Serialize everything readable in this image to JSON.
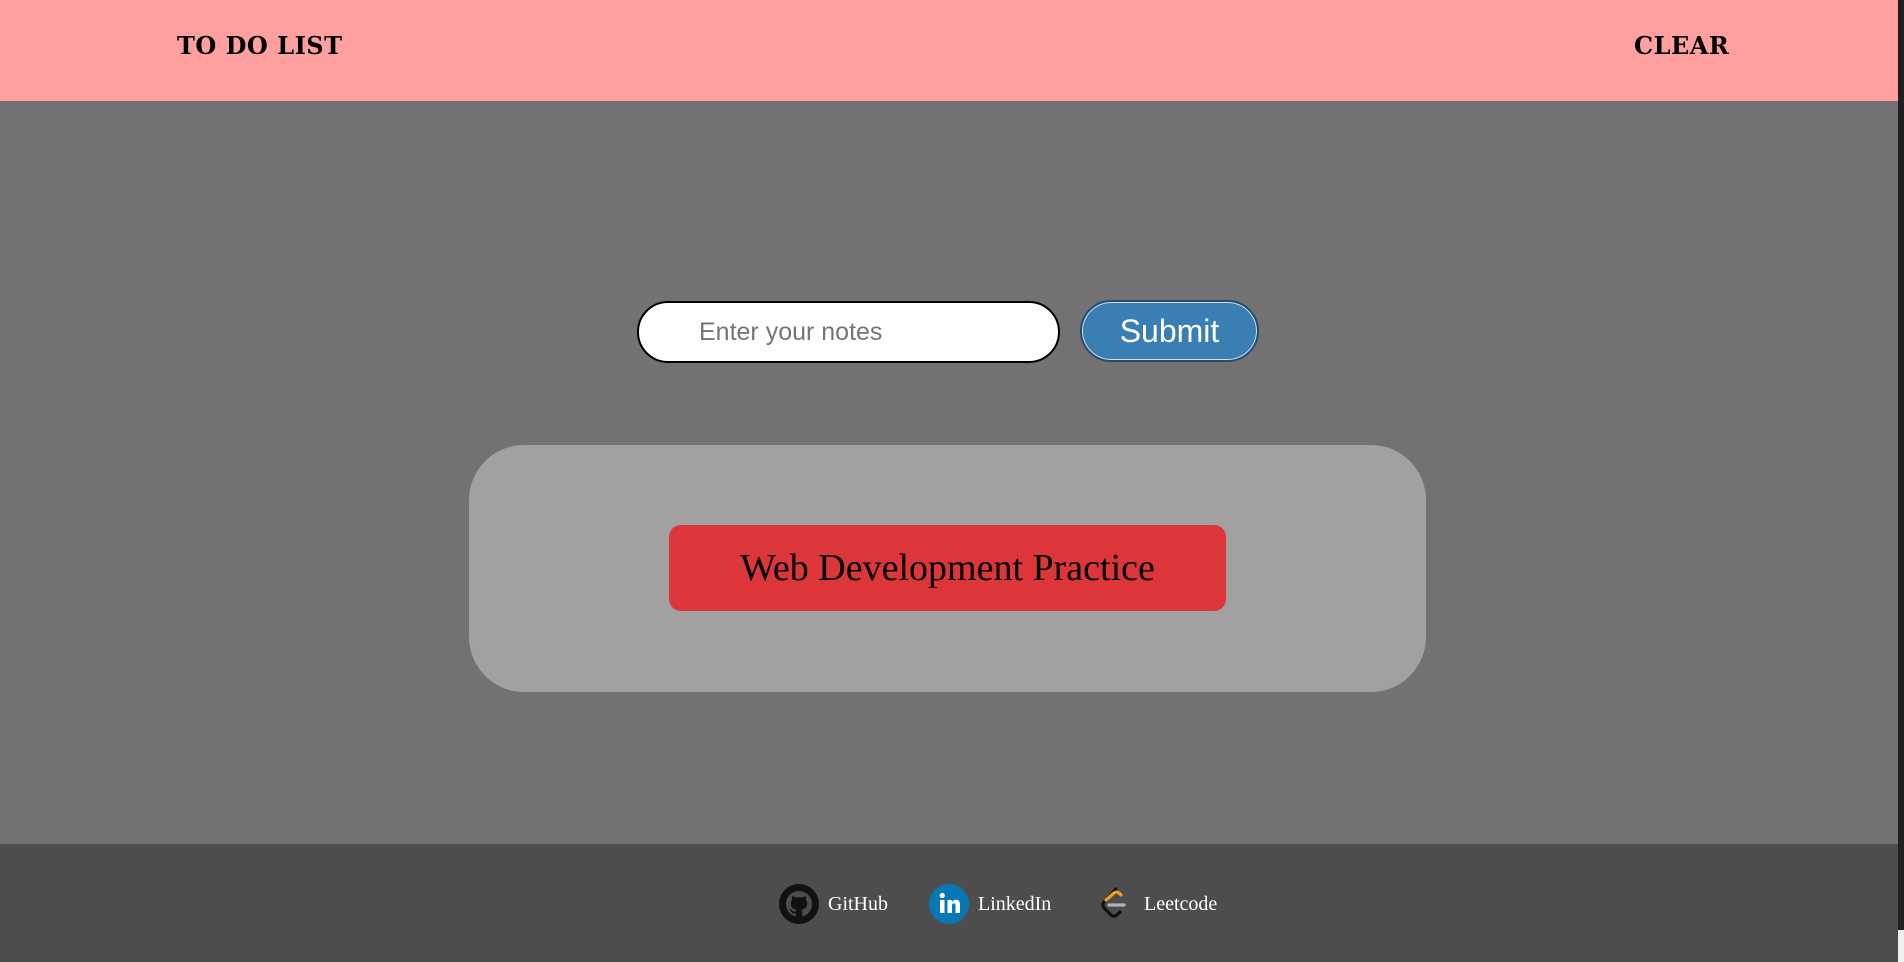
{
  "navbar": {
    "title": "TO DO LIST",
    "clear_label": "CLEAR",
    "background": "#ffa0a0"
  },
  "form": {
    "input_placeholder": "Enter your notes",
    "input_value": "",
    "submit_label": "Submit",
    "submit_color": "#3a7fb3"
  },
  "notes": {
    "panel_color": "#a1a1a1",
    "items": [
      {
        "text": "Web Development Practice",
        "color": "#dc353a"
      }
    ]
  },
  "footer": {
    "links": [
      {
        "label": "GitHub",
        "icon": "github-icon"
      },
      {
        "label": "LinkedIn",
        "icon": "linkedin-icon"
      },
      {
        "label": "Leetcode",
        "icon": "leetcode-icon"
      }
    ]
  }
}
